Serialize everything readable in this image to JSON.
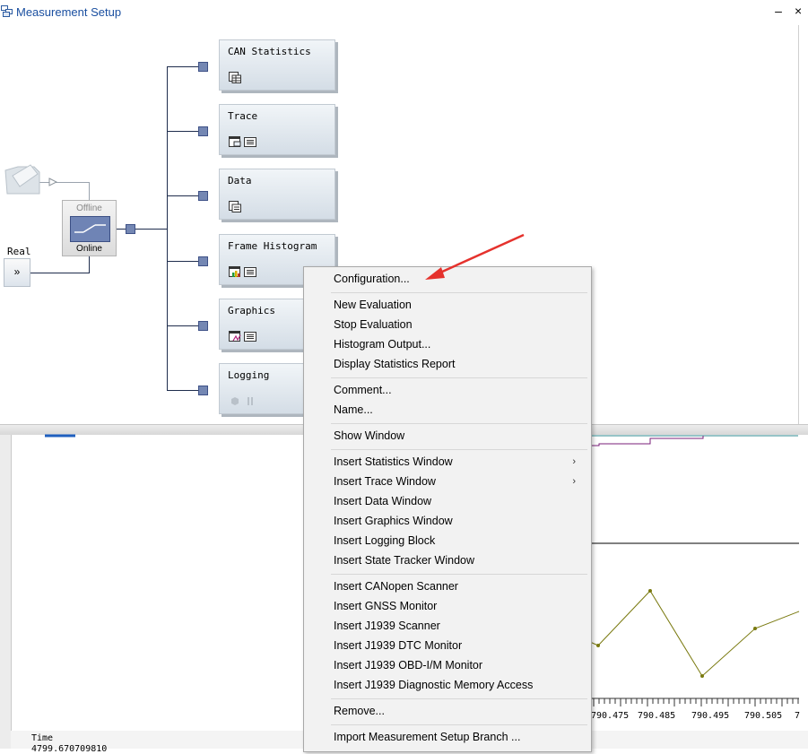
{
  "window": {
    "title": "Measurement Setup",
    "minimize_symbol": "–",
    "close_symbol": "×"
  },
  "switch": {
    "offline_label": "Offline",
    "online_label": "Online"
  },
  "real": {
    "label": "Real",
    "button_symbol": "»"
  },
  "blocks": [
    {
      "label": "CAN Statistics",
      "icons": [
        "statistics-table-icon"
      ]
    },
    {
      "label": "Trace",
      "icons": [
        "trace-window-icon",
        "list-icon"
      ]
    },
    {
      "label": "Data",
      "icons": [
        "data-window-icon"
      ]
    },
    {
      "label": "Frame Histogram",
      "icons": [
        "histogram-icon",
        "list-icon"
      ]
    },
    {
      "label": "Graphics",
      "icons": [
        "graphics-window-icon",
        "list-icon"
      ]
    },
    {
      "label": "Logging",
      "icons": [
        "record-icon",
        "pause-icon"
      ]
    }
  ],
  "context_menu": {
    "items": [
      {
        "label": "Configuration..."
      },
      {
        "label": "New Evaluation"
      },
      {
        "label": "Stop Evaluation"
      },
      {
        "label": "Histogram Output..."
      },
      {
        "label": "Display Statistics Report"
      },
      {
        "label": "Comment..."
      },
      {
        "label": "Name..."
      },
      {
        "label": "Show Window"
      },
      {
        "label": "Insert Statistics Window",
        "submenu": true,
        "arrow": "›"
      },
      {
        "label": "Insert Trace Window",
        "submenu": true,
        "arrow": "›"
      },
      {
        "label": "Insert Data Window"
      },
      {
        "label": "Insert Graphics Window"
      },
      {
        "label": "Insert Logging Block"
      },
      {
        "label": "Insert State Tracker Window"
      },
      {
        "label": "Insert CANopen Scanner"
      },
      {
        "label": "Insert GNSS Monitor"
      },
      {
        "label": "Insert J1939 Scanner"
      },
      {
        "label": "Insert J1939 DTC Monitor"
      },
      {
        "label": "Insert J1939 OBD-I/M Monitor"
      },
      {
        "label": "Insert J1939 Diagnostic Memory Access"
      },
      {
        "label": "Remove..."
      },
      {
        "label": "Import Measurement Setup Branch ..."
      }
    ]
  },
  "graph": {
    "time_label": "Time",
    "time_value": "4799.670709810",
    "x_tick_labels": [
      "790.475",
      "790.485",
      "790.495",
      "790.505",
      "7"
    ],
    "line_colors": {
      "purple": "#7a1f7a",
      "olive": "#7a7a10",
      "teal": "#2c8a8f",
      "blue": "#1f5fbf"
    }
  },
  "annotation": {
    "arrow_color": "#e5322d"
  }
}
